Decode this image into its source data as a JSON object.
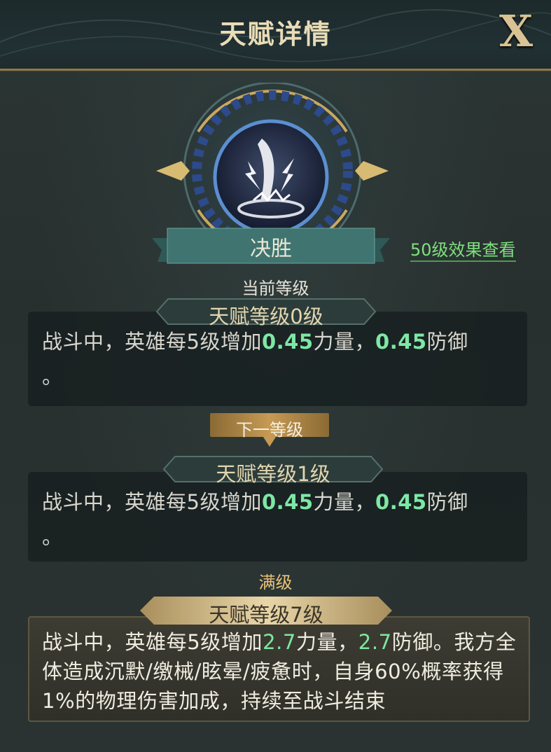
{
  "header": {
    "title": "天赋详情",
    "close_label": "X"
  },
  "talent": {
    "name": "决胜",
    "icon": "lightning-blade-icon"
  },
  "links": {
    "level50": "50级效果查看"
  },
  "current": {
    "title": "当前等级",
    "level_label": "天赋等级0级",
    "desc_a": "战斗中，英雄每5级增加",
    "value1": "0.45",
    "desc_b": "力量，",
    "value2": "0.45",
    "desc_c": "防御",
    "desc_d": "。"
  },
  "next": {
    "button_label": "下一等级",
    "level_label": "天赋等级1级",
    "desc_a": "战斗中，英雄每5级增加",
    "value1": "0.45",
    "desc_b": "力量，",
    "value2": "0.45",
    "desc_c": "防御",
    "desc_d": "。"
  },
  "max": {
    "title": "满级",
    "level_label": "天赋等级7级",
    "desc_a": "战斗中，英雄每5级增加",
    "value1": "2.7",
    "desc_b": "力量，",
    "value2": "2.7",
    "desc_c": "防御。我方全体造成沉默/缴械/眩晕/疲惫时，自身60%概率获得1%的物理伤害加成，持续至战斗结束"
  },
  "colors": {
    "accent_gold": "#e9c27a",
    "value_green": "#7de8a5",
    "link_green": "#7fe07e"
  }
}
